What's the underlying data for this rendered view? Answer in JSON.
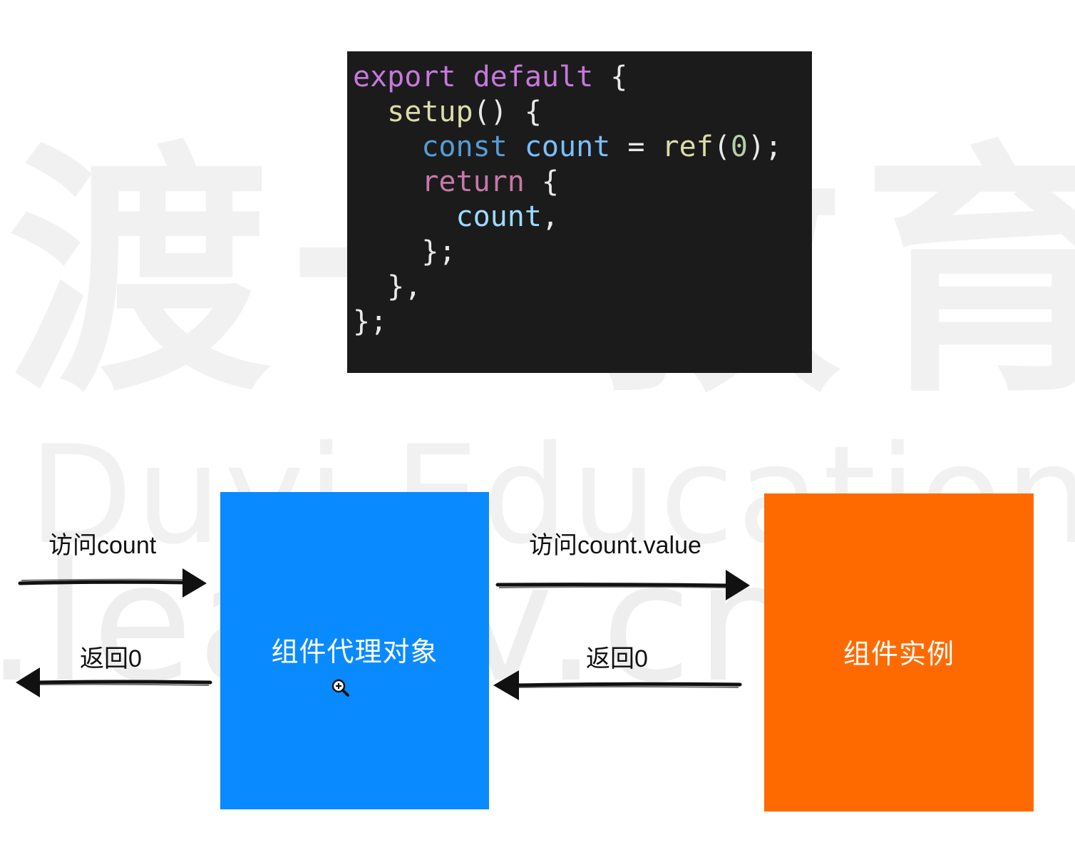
{
  "watermark": {
    "chinese": "渡一教育",
    "english": "Duyi Education",
    "url": ".leaaiv.cn"
  },
  "code": {
    "lines": [
      [
        {
          "t": "export default",
          "c": "kw"
        },
        {
          "t": " {",
          "c": "punc"
        }
      ],
      [
        {
          "t": "  "
        },
        {
          "t": "setup",
          "c": "fn"
        },
        {
          "t": "() {",
          "c": "punc"
        }
      ],
      [
        {
          "t": "    "
        },
        {
          "t": "const",
          "c": "decl"
        },
        {
          "t": " "
        },
        {
          "t": "count",
          "c": "var2"
        },
        {
          "t": " = ",
          "c": "punc"
        },
        {
          "t": "ref",
          "c": "fn"
        },
        {
          "t": "(",
          "c": "punc"
        },
        {
          "t": "0",
          "c": "num"
        },
        {
          "t": ");",
          "c": "punc"
        }
      ],
      [
        {
          "t": "    "
        },
        {
          "t": "return",
          "c": "kw2"
        },
        {
          "t": " {",
          "c": "punc"
        }
      ],
      [
        {
          "t": "      "
        },
        {
          "t": "count",
          "c": "var"
        },
        {
          "t": ",",
          "c": "punc"
        }
      ],
      [
        {
          "t": "    "
        },
        {
          "t": "};",
          "c": "punc"
        }
      ],
      [
        {
          "t": "  "
        },
        {
          "t": "},",
          "c": "punc"
        }
      ],
      [
        {
          "t": "};",
          "c": "punc"
        }
      ]
    ]
  },
  "diagram": {
    "proxy_box": {
      "label": "组件代理对象",
      "color": "#0a8aff"
    },
    "instance_box": {
      "label": "组件实例",
      "color": "#ff6a00"
    },
    "edges": {
      "access_count": "访问count",
      "return_0_left": "返回0",
      "access_count_value": "访问count.value",
      "return_0_right": "返回0"
    }
  },
  "icons": {
    "cursor": "zoom-in-cursor-icon"
  }
}
